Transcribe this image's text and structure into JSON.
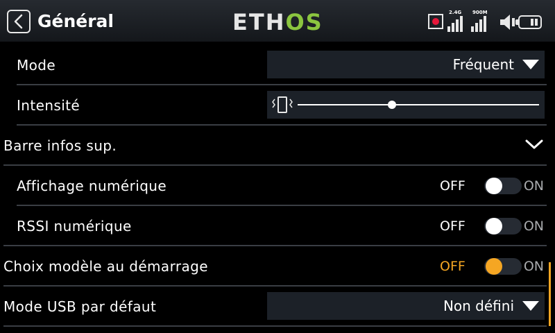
{
  "header": {
    "title": "Général",
    "logo_left": "ETH",
    "logo_right": "OS",
    "signal1_label": "2.4G",
    "signal2_label": "900M",
    "icons": [
      "back-icon",
      "record-icon",
      "signal-2-4g-icon",
      "signal-900m-icon",
      "speaker-icon",
      "battery-icon"
    ]
  },
  "colors": {
    "accent": "#f5a623",
    "logo_green": "#8bc53f",
    "field_bg": "#1c2128",
    "record_red": "#e6173a"
  },
  "rows": {
    "mode": {
      "label": "Mode",
      "value": "Fréquent"
    },
    "intensity": {
      "label": "Intensité",
      "level": 0.39
    },
    "section": {
      "label": "Barre infos sup."
    },
    "numeric_display": {
      "label": "Affichage numérique",
      "off": "OFF",
      "on": "ON",
      "state": "off"
    },
    "rssi_numeric": {
      "label": "RSSI numérique",
      "off": "OFF",
      "on": "ON",
      "state": "off"
    },
    "model_choice": {
      "label": "Choix modèle au démarrage",
      "off": "OFF",
      "on": "ON",
      "state": "off",
      "focused": true
    },
    "usb_mode": {
      "label": "Mode USB par défaut",
      "value": "Non défini"
    }
  }
}
